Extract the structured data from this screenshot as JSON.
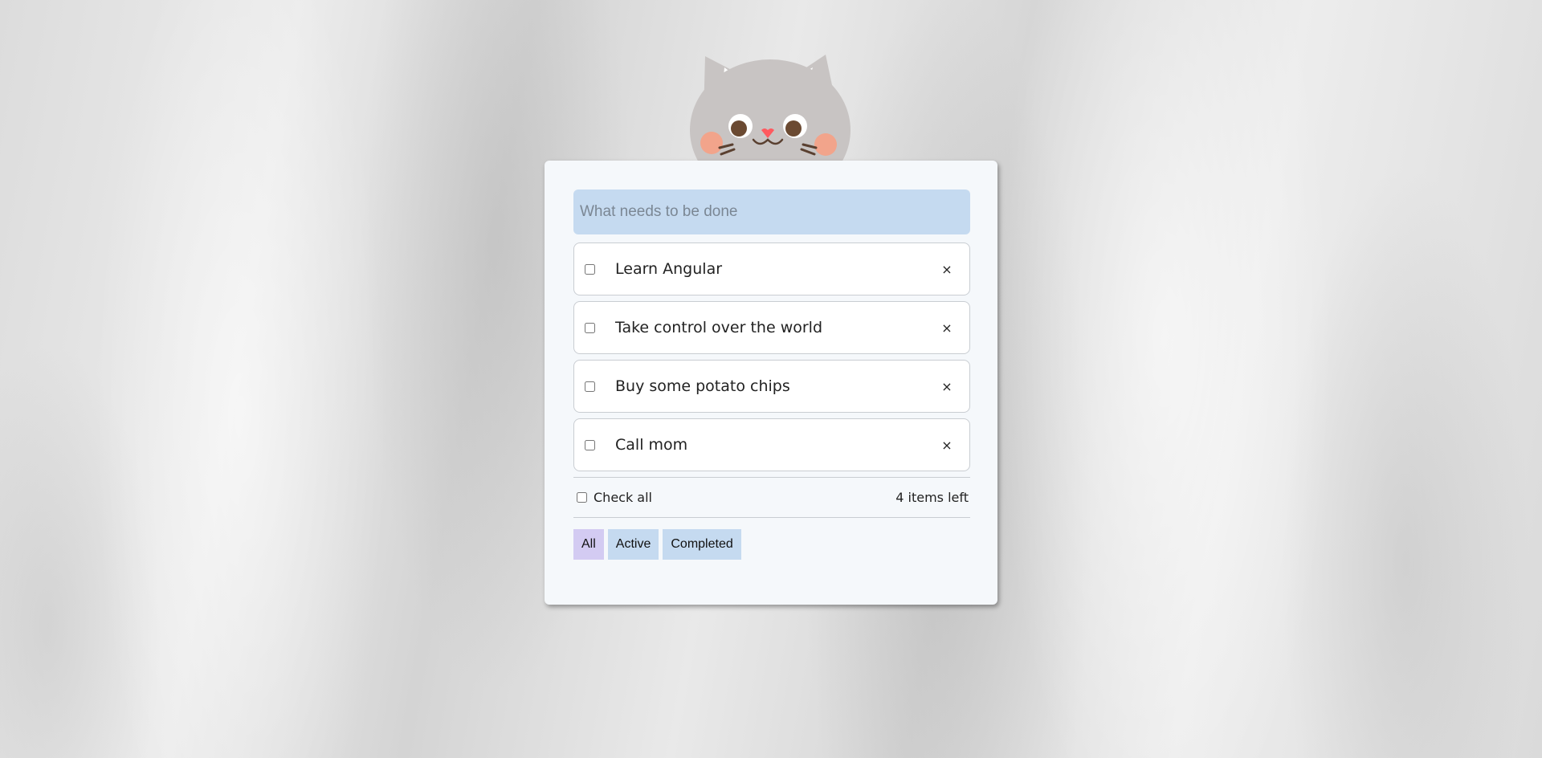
{
  "new_todo": {
    "placeholder": "What needs to be done",
    "value": ""
  },
  "todos": [
    {
      "title": "Learn Angular",
      "completed": false,
      "delete_label": "×"
    },
    {
      "title": "Take control over the world",
      "completed": false,
      "delete_label": "×"
    },
    {
      "title": "Buy some potato chips",
      "completed": false,
      "delete_label": "×"
    },
    {
      "title": "Call mom",
      "completed": false,
      "delete_label": "×"
    }
  ],
  "footer": {
    "check_all_label": "Check all",
    "items_left": "4 items left"
  },
  "filters": [
    {
      "label": "All",
      "selected": true
    },
    {
      "label": "Active",
      "selected": false
    },
    {
      "label": "Completed",
      "selected": false
    }
  ],
  "colors": {
    "input_bg": "#c5daf0",
    "filter_selected": "#d3cbf2",
    "filter_default": "#c5daf0",
    "card_bg": "#f5f8fb"
  },
  "icons": {
    "mascot": "cat-mascot-icon",
    "delete": "close-icon"
  }
}
